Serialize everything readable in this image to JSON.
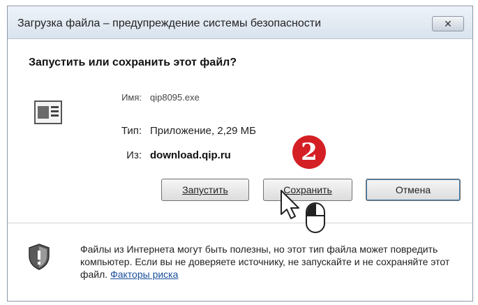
{
  "window": {
    "title": "Загрузка файла – предупреждение системы безопасности",
    "close_label": "✕"
  },
  "question": "Запустить или сохранить этот файл?",
  "file": {
    "name_label": "Имя:",
    "name_value": "qip8095.exe",
    "type_label": "Тип:",
    "type_value": "Приложение, 2,29 МБ",
    "from_label": "Из:",
    "from_value": "download.qip.ru"
  },
  "step_badge": "2",
  "buttons": {
    "run": "Запустить",
    "save": "Сохранить",
    "cancel": "Отмена"
  },
  "warning": {
    "text": "Файлы из Интернета могут быть полезны, но этот тип файла может повредить компьютер. Если вы не доверяете источнику, не запускайте и не сохраняйте этот файл. ",
    "link": "Факторы риска"
  }
}
